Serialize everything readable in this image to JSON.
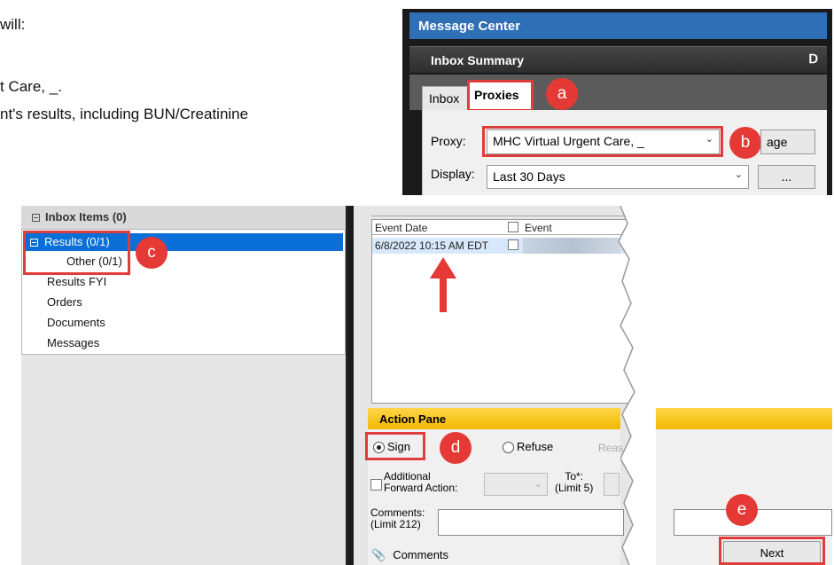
{
  "intro": {
    "line1": "will:",
    "line2": "t Care, _.",
    "line3": "nt's results, including BUN/Creatinine"
  },
  "message_center": {
    "title": "Message Center",
    "summary": "Inbox Summary",
    "pin_icon": "pin-icon",
    "tabs": {
      "inbox": "Inbox",
      "proxies": "Proxies"
    },
    "proxy_label": "Proxy:",
    "proxy_value": "MHC Virtual Urgent Care, _",
    "manage_label": "age",
    "display_label": "Display:",
    "display_value": "Last 30 Days",
    "ellipsis_label": "..."
  },
  "inbox_items": {
    "header": "Inbox Items (0)",
    "results": "Results (0/1)",
    "other": "Other (0/1)",
    "results_fyi": "Results FYI",
    "orders": "Orders",
    "documents": "Documents",
    "messages": "Messages"
  },
  "events": {
    "col_date": "Event Date",
    "col_event": "Event",
    "row_date": "6/8/2022 10:15 AM EDT"
  },
  "action_pane": {
    "title": "Action Pane",
    "sign": "Sign",
    "refuse": "Refuse",
    "reason": "Reas",
    "additional_line1": "Additional",
    "additional_line2": "Forward Action:",
    "to_line1": "To*:",
    "to_line2": "(Limit 5)",
    "comments_line1": "Comments:",
    "comments_line2": "(Limit 212)",
    "comments_link": "Comments",
    "next": "Next"
  },
  "callouts": {
    "a": "a",
    "b": "b",
    "c": "c",
    "d": "d",
    "e": "e"
  },
  "colors": {
    "highlight": "#e03c3c",
    "badge": "#e53935",
    "title_blue": "#2f6fb5",
    "selection": "#0a6fd6",
    "action_yellow": "#f2b800"
  }
}
